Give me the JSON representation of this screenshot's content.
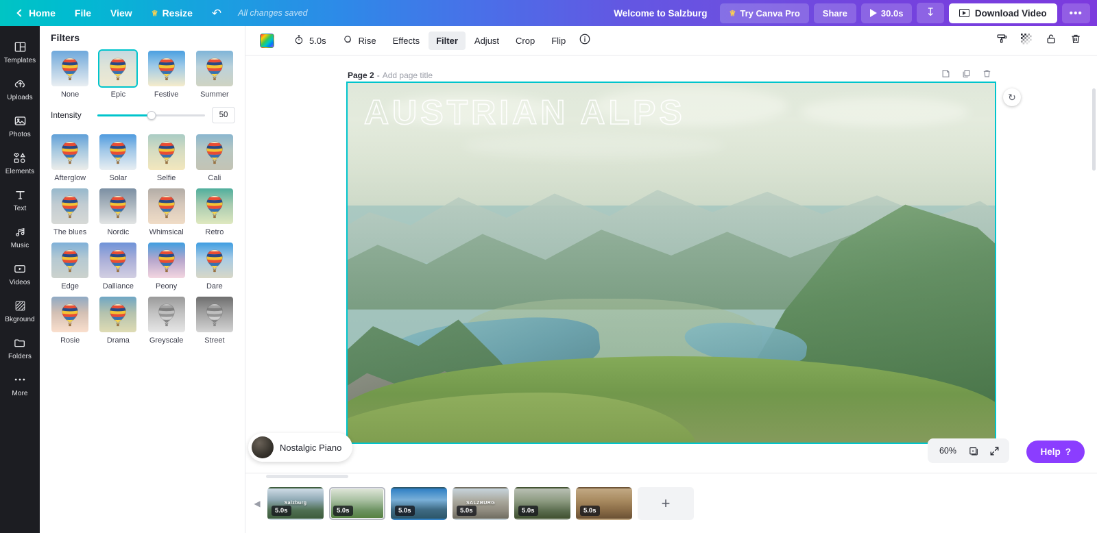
{
  "topbar": {
    "back_label": "Home",
    "menus": [
      "File",
      "View"
    ],
    "resize_label": "Resize",
    "undo_label": "Undo",
    "saved_status": "All changes saved",
    "doc_title": "Welcome to Salzburg",
    "try_pro_label": "Try Canva Pro",
    "share_label": "Share",
    "duration_label": "30.0s",
    "download_icon_label": "Download",
    "download_video_label": "Download Video",
    "more_label": "•••",
    "gradient_start": "#00c4c4",
    "gradient_end": "#7c3ade"
  },
  "rail": {
    "items": [
      {
        "label": "Templates",
        "icon": "templates-icon"
      },
      {
        "label": "Uploads",
        "icon": "cloud-upload-icon"
      },
      {
        "label": "Photos",
        "icon": "photo-icon"
      },
      {
        "label": "Elements",
        "icon": "shapes-icon"
      },
      {
        "label": "Text",
        "icon": "text-icon"
      },
      {
        "label": "Music",
        "icon": "music-note-icon"
      },
      {
        "label": "Videos",
        "icon": "video-icon"
      },
      {
        "label": "Bkground",
        "icon": "background-icon"
      },
      {
        "label": "Folders",
        "icon": "folder-icon"
      },
      {
        "label": "More",
        "icon": "ellipsis-icon"
      }
    ]
  },
  "panel": {
    "title": "Filters",
    "intensity_label": "Intensity",
    "intensity_value": "50",
    "intensity_percent": 50,
    "selected_filter": "Epic",
    "filters": [
      {
        "name": "None",
        "sky": "linear-gradient(180deg,#6ea8dc 0%,#a8c8e4 45%,#e9eef2 100%)"
      },
      {
        "name": "Epic",
        "sky": "linear-gradient(180deg,#c6d9e0 0%,#dfe4d8 45%,#efe9d2 100%)"
      },
      {
        "name": "Festive",
        "sky": "linear-gradient(180deg,#4a9fe0 0%,#9cc9e8 42%,#f6eccb 100%)"
      },
      {
        "name": "Summer",
        "sky": "linear-gradient(180deg,#7fb4d8 0%,#bcd2da 45%,#cfd3c2 100%)"
      },
      {
        "name": "Afterglow",
        "sky": "linear-gradient(180deg,#5f9fd8 0%,#a6c8e0 45%,#ecedea 100%)"
      },
      {
        "name": "Solar",
        "sky": "linear-gradient(180deg,#4f9bdf 0%,#a2c8e8 45%,#e8eef2 100%)"
      },
      {
        "name": "Selfie",
        "sky": "linear-gradient(180deg,#a9ccc4 0%,#d5dcc2 45%,#f3e7bd 100%)"
      },
      {
        "name": "Cali",
        "sky": "linear-gradient(180deg,#8ab6cf 0%,#b9c8c2 45%,#c3c3b4 100%)"
      },
      {
        "name": "The blues",
        "sky": "linear-gradient(180deg,#96b8cc 0%,#c2ccd2 45%,#d7d9d6 100%)"
      },
      {
        "name": "Nordic",
        "sky": "linear-gradient(180deg,#7b8fa3 0%,#a9b4bd 45%,#e2e4e4 100%)"
      },
      {
        "name": "Whimsical",
        "sky": "linear-gradient(180deg,#b2aca6 0%,#d6c8bb 45%,#f0dcc6 100%)"
      },
      {
        "name": "Retro",
        "sky": "linear-gradient(180deg,#4fae9c 0%,#a8cbb0 45%,#dfe8bf 100%)"
      },
      {
        "name": "Edge",
        "sky": "linear-gradient(180deg,#7fb0d8 0%,#b5c9d2 45%,#ccd2cd 100%)"
      },
      {
        "name": "Dalliance",
        "sky": "linear-gradient(180deg,#6f93d8 0%,#a8add8 45%,#d3cfe2 100%)"
      },
      {
        "name": "Peony",
        "sky": "linear-gradient(180deg,#3f9ee0 0%,#b6a6cc 48%,#f4d6e0 100%)"
      },
      {
        "name": "Dare",
        "sky": "linear-gradient(180deg,#3e9de2 0%,#a8cbe4 45%,#d8d7c6 100%)"
      },
      {
        "name": "Rosie",
        "sky": "linear-gradient(180deg,#8fa9c4 0%,#d3c0b4 45%,#fadfcd 100%)"
      },
      {
        "name": "Drama",
        "sky": "linear-gradient(180deg,#6fa6c4 0%,#b4c2ae 45%,#dfdcb4 100%)"
      },
      {
        "name": "Greyscale",
        "sky": "linear-gradient(180deg,#9a9a9a 0%,#c2c2c2 45%,#e6e6e6 100%)",
        "grey": true
      },
      {
        "name": "Street",
        "sky": "linear-gradient(180deg,#6f6f6f 0%,#a0a0a0 45%,#d4d4d4 100%)",
        "grey": true
      }
    ]
  },
  "context_toolbar": {
    "color_swatch_label": "Color",
    "duration_label": "5.0s",
    "animation_label": "Rise",
    "items": [
      "Effects",
      "Filter",
      "Adjust",
      "Crop",
      "Flip"
    ],
    "active_item": "Filter",
    "info_label": "Info",
    "right_icons": [
      {
        "name": "copy-style-icon",
        "label": "Copy style"
      },
      {
        "name": "transparency-icon",
        "label": "Transparency"
      },
      {
        "name": "lock-icon",
        "label": "Lock"
      },
      {
        "name": "delete-icon",
        "label": "Delete"
      }
    ]
  },
  "canvas": {
    "page_number": "Page 2",
    "page_separator": "-",
    "page_title_placeholder": "Add page title",
    "headline": "AUSTRIAN ALPS",
    "page_actions": [
      {
        "name": "add-note-icon",
        "label": "Add note"
      },
      {
        "name": "duplicate-page-icon",
        "label": "Duplicate page"
      },
      {
        "name": "delete-page-icon",
        "label": "Delete page"
      }
    ],
    "rotate_label": "Rotate"
  },
  "audio": {
    "track_name": "Nostalgic Piano"
  },
  "zoom_controls": {
    "zoom_level": "60%",
    "pages_icon_label": "6",
    "fullscreen_label": "Fullscreen"
  },
  "help": {
    "label": "Help",
    "question_mark": "?"
  },
  "timeline": {
    "add_label": "+",
    "selected_index": 1,
    "clips": [
      {
        "duration": "5.0s",
        "title": "Salzburg",
        "bg": "linear-gradient(180deg,#cfdce6 0%,#8fa9b4 38%,#4f6f52 72%,#3d5c3c 100%)"
      },
      {
        "duration": "5.0s",
        "title": "",
        "bg": "linear-gradient(180deg,#dfe6d8 0%,#a7bfa0 40%,#6b9160 74%,#55803f 100%)"
      },
      {
        "duration": "5.0s",
        "title": "",
        "bg": "linear-gradient(180deg,#2e7fc4 0%,#79b0d8 38%,#3f6b84 70%,#2c5668 100%)"
      },
      {
        "duration": "5.0s",
        "title": "SALZBURG",
        "bg": "linear-gradient(180deg,#c7d4dc 0%,#a9a79c 42%,#8e8a7e 74%,#6f6c60 100%)"
      },
      {
        "duration": "5.0s",
        "title": "",
        "bg": "linear-gradient(180deg,#b9c0b4 0%,#8c9a80 42%,#586a4c 76%,#40502f 100%)"
      },
      {
        "duration": "5.0s",
        "title": "",
        "bg": "linear-gradient(180deg,#c2a984 0%,#a88a60 40%,#8a6c47 72%,#6a5134 100%)"
      }
    ]
  }
}
